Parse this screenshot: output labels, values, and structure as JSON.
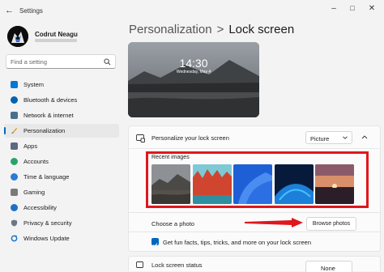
{
  "window": {
    "title": "Settings",
    "controls": [
      "minimize",
      "maximize",
      "close"
    ]
  },
  "user": {
    "name": "Codrut Neagu"
  },
  "search": {
    "placeholder": "Find a setting"
  },
  "sidebar": {
    "items": [
      {
        "label": "System",
        "icon": "monitor-icon",
        "color": "#0078d4"
      },
      {
        "label": "Bluetooth & devices",
        "icon": "bluetooth-icon",
        "color": "#0063b1"
      },
      {
        "label": "Network & internet",
        "icon": "network-icon",
        "color": "#4a6f8a"
      },
      {
        "label": "Personalization",
        "icon": "brush-icon",
        "color": "#e09820",
        "active": true
      },
      {
        "label": "Apps",
        "icon": "apps-icon",
        "color": "#5a6a80"
      },
      {
        "label": "Accounts",
        "icon": "person-icon",
        "color": "#2aa36b"
      },
      {
        "label": "Time & language",
        "icon": "clock-icon",
        "color": "#2b7ad6"
      },
      {
        "label": "Gaming",
        "icon": "gamepad-icon",
        "color": "#7a7a7a"
      },
      {
        "label": "Accessibility",
        "icon": "accessibility-icon",
        "color": "#1f6fc4"
      },
      {
        "label": "Privacy & security",
        "icon": "shield-icon",
        "color": "#6b7785"
      },
      {
        "label": "Windows Update",
        "icon": "update-icon",
        "color": "#1a73c9"
      }
    ]
  },
  "header": {
    "parent": "Personalization",
    "separator": ">",
    "current": "Lock screen"
  },
  "preview": {
    "time": "14:30",
    "date": "Wednesday, May 4"
  },
  "lock_screen": {
    "personalize_label": "Personalize your lock screen",
    "personalize_value": "Picture",
    "recent_images_label": "Recent images",
    "choose_photo_label": "Choose a photo",
    "browse_label": "Browse photos",
    "fun_facts_label": "Get fun facts, tips, tricks, and more on your lock screen",
    "fun_facts_checked": true,
    "status_label": "Lock screen status",
    "status_value": "None"
  },
  "colors": {
    "accent": "#0067c0",
    "highlight_red": "#e0171c"
  }
}
